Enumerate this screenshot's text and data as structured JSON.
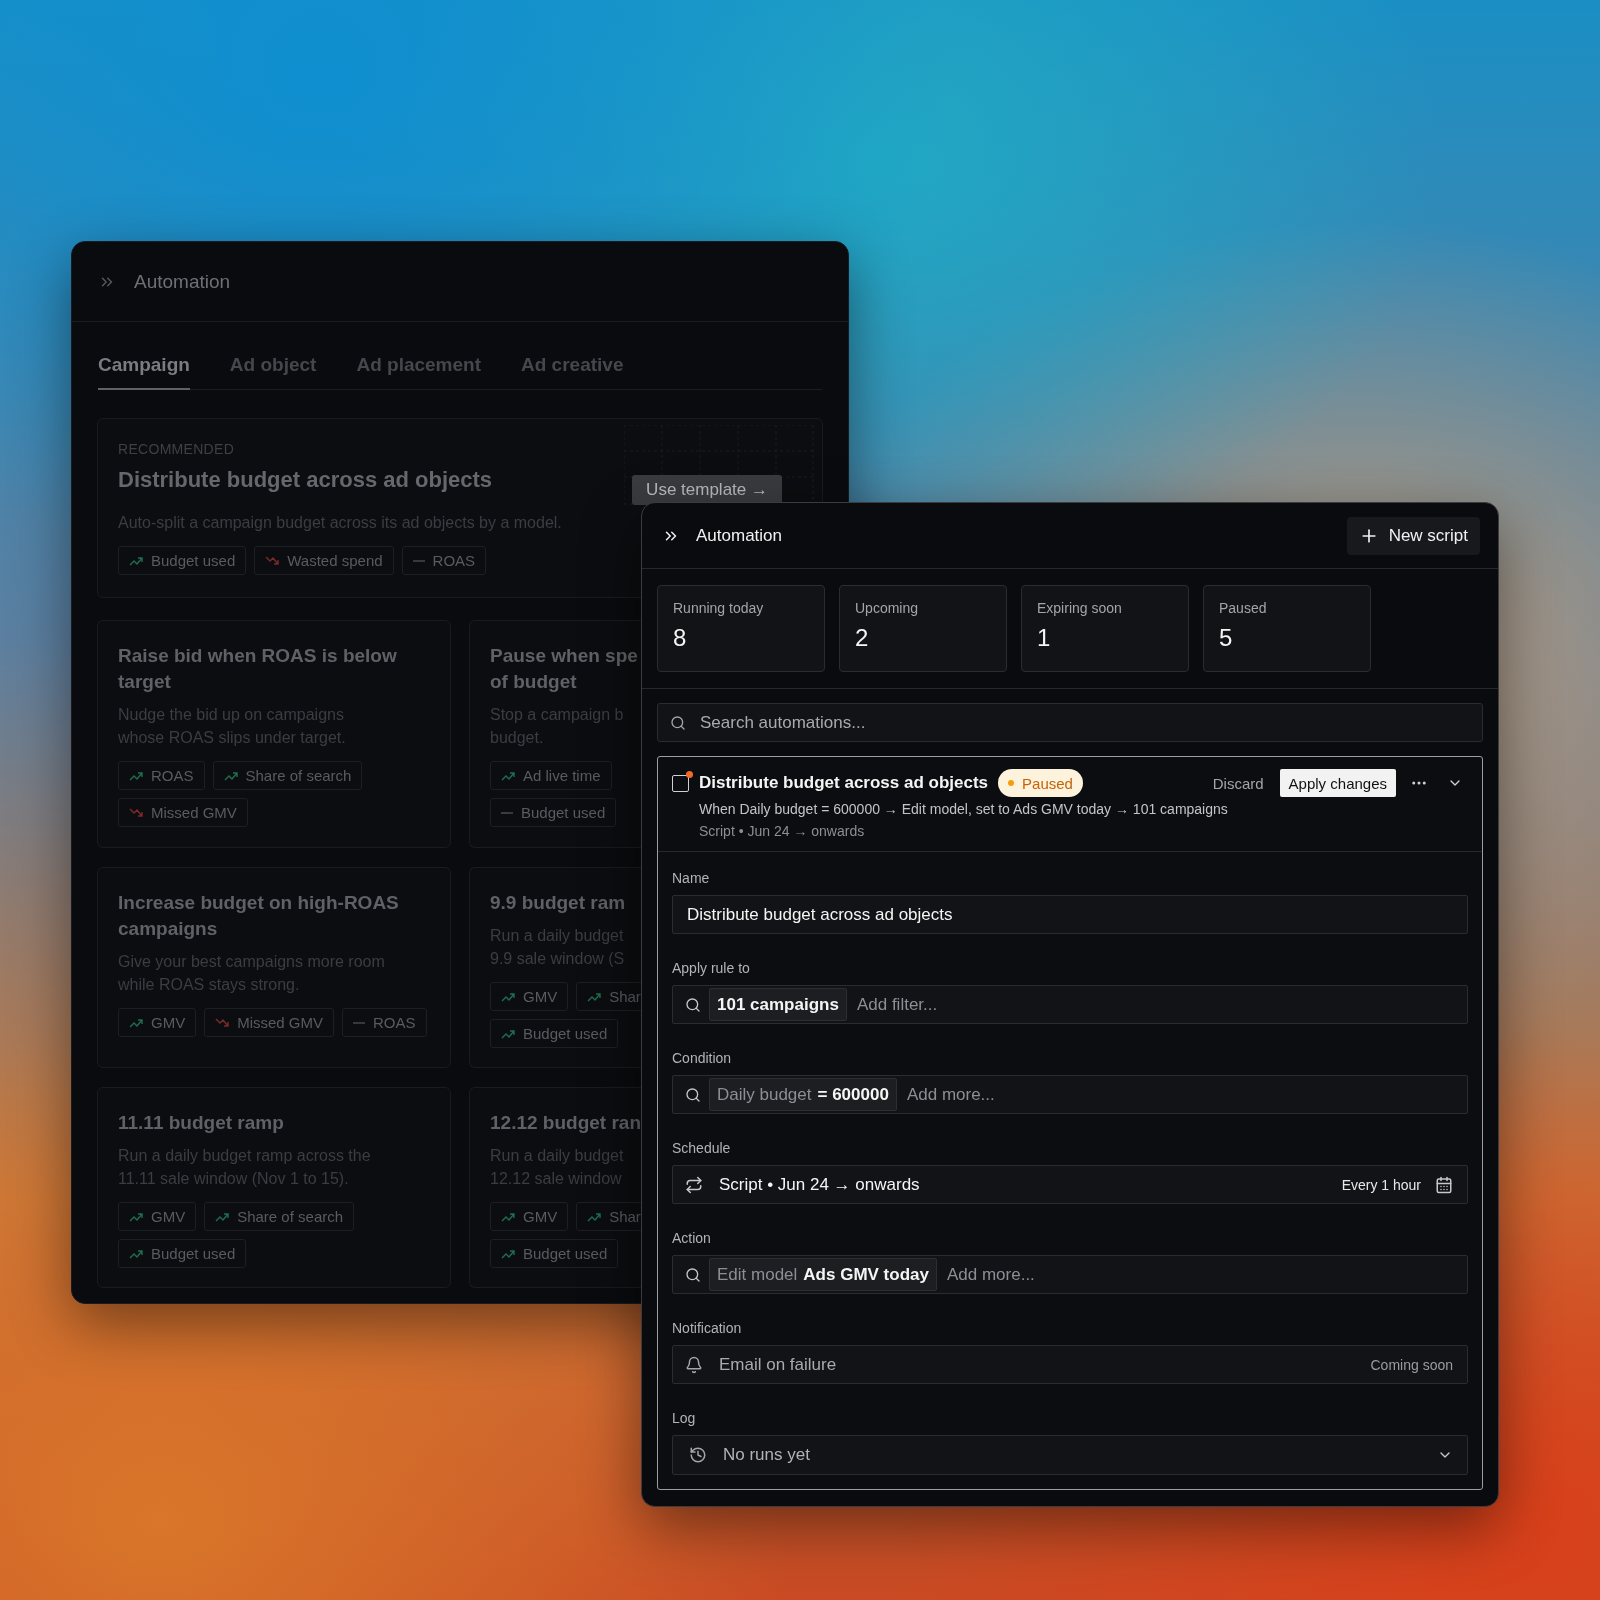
{
  "back_window": {
    "title": "Automation",
    "tabs": [
      {
        "label": "Campaign",
        "selected": true
      },
      {
        "label": "Ad object",
        "selected": false
      },
      {
        "label": "Ad placement",
        "selected": false
      },
      {
        "label": "Ad creative",
        "selected": false
      }
    ],
    "recommended": {
      "eyebrow": "RECOMMENDED",
      "title": "Distribute budget across ad objects",
      "description": "Auto-split a campaign budget across its ad objects by a model.",
      "button": "Use template →",
      "chips": [
        {
          "label": "Budget used",
          "kind": "up"
        },
        {
          "label": "Wasted spend",
          "kind": "down"
        },
        {
          "label": "ROAS",
          "kind": "flat"
        }
      ]
    },
    "cards": [
      {
        "title_lines": [
          "Raise bid when ROAS is below",
          "target"
        ],
        "description_lines": [
          "Nudge the bid up on campaigns",
          "whose ROAS slips under target."
        ],
        "chip_rows": [
          [
            {
              "label": "ROAS",
              "kind": "up"
            },
            {
              "label": "Share of search",
              "kind": "up"
            }
          ],
          [
            {
              "label": "Missed GMV",
              "kind": "down"
            }
          ]
        ]
      },
      {
        "title_lines": [
          "Pause when spe",
          "of budget"
        ],
        "description_lines": [
          "Stop a campaign b",
          "budget."
        ],
        "chip_rows": [
          [
            {
              "label": "Ad live time",
              "kind": "up"
            }
          ],
          [
            {
              "label": "Budget used",
              "kind": "flat"
            }
          ]
        ]
      },
      {
        "title_lines": [
          "Increase budget on high-ROAS",
          "campaigns"
        ],
        "description_lines": [
          "Give your best campaigns more room",
          "while ROAS stays strong."
        ],
        "chip_rows": [
          [
            {
              "label": "GMV",
              "kind": "up"
            },
            {
              "label": "Missed GMV",
              "kind": "down"
            },
            {
              "label": "ROAS",
              "kind": "flat"
            }
          ]
        ]
      },
      {
        "title_lines": [
          "9.9 budget ram"
        ],
        "description_lines": [
          "Run a daily budget",
          "9.9 sale window (S"
        ],
        "chip_rows": [
          [
            {
              "label": "GMV",
              "kind": "up"
            },
            {
              "label": "Shar",
              "kind": "up"
            }
          ],
          [
            {
              "label": "Budget used",
              "kind": "up"
            }
          ]
        ]
      },
      {
        "title_lines": [
          "11.11 budget ramp"
        ],
        "description_lines": [
          "Run a daily budget ramp across the",
          "11.11 sale window (Nov 1 to 15)."
        ],
        "chip_rows": [
          [
            {
              "label": "GMV",
              "kind": "up"
            },
            {
              "label": "Share of search",
              "kind": "up"
            }
          ],
          [
            {
              "label": "Budget used",
              "kind": "up"
            }
          ]
        ]
      },
      {
        "title_lines": [
          "12.12 budget ran"
        ],
        "description_lines": [
          "Run a daily budget",
          "12.12 sale window"
        ],
        "chip_rows": [
          [
            {
              "label": "GMV",
              "kind": "up"
            },
            {
              "label": "Shar",
              "kind": "up"
            }
          ],
          [
            {
              "label": "Budget used",
              "kind": "up"
            }
          ]
        ]
      }
    ]
  },
  "front_window": {
    "title": "Automation",
    "new_button": "New script",
    "stats": [
      {
        "label": "Running today",
        "value": "8"
      },
      {
        "label": "Upcoming",
        "value": "2"
      },
      {
        "label": "Expiring soon",
        "value": "1"
      },
      {
        "label": "Paused",
        "value": "5"
      }
    ],
    "search": {
      "placeholder": "Search automations..."
    },
    "item": {
      "title": "Distribute budget across ad objects",
      "checked": false,
      "has_changes": true,
      "expanded": true,
      "status": "Paused",
      "discard": "Discard",
      "apply": "Apply changes",
      "summary": "When Daily budget = 600000 → Edit model, set to Ads GMV today → 101 campaigns",
      "schedule_line": "Script • Jun 24 → onwards",
      "fields": [
        {
          "label": "Name",
          "kind": "text",
          "value": "Distribute budget across ad objects"
        },
        {
          "label": "Apply rule to",
          "kind": "tokens",
          "token": [
            {
              "text": "101 campaigns",
              "muted": false
            }
          ],
          "placeholder": "Add filter..."
        },
        {
          "label": "Condition",
          "kind": "tokens",
          "token": [
            {
              "text": "Daily budget",
              "muted": true
            },
            {
              "text": "= 600000",
              "muted": false
            }
          ],
          "placeholder": "Add more..."
        },
        {
          "label": "Schedule",
          "kind": "schedule",
          "value": "Script • Jun 24 → onwards",
          "aside": "Every 1 hour"
        },
        {
          "label": "Action",
          "kind": "tokens",
          "token": [
            {
              "text": "Edit model",
              "muted": true
            },
            {
              "text": "Ads GMV today",
              "muted": false
            }
          ],
          "placeholder": "Add more..."
        },
        {
          "label": "Notification",
          "kind": "notification",
          "value": "Email on failure",
          "aside": "Coming soon"
        },
        {
          "label": "Log",
          "kind": "select",
          "value": "No runs yet"
        }
      ]
    }
  }
}
